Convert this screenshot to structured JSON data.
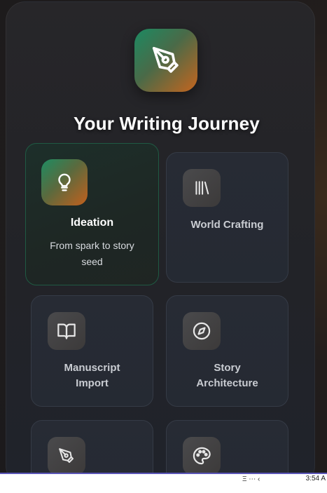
{
  "header": {
    "title": "Your Writing Journey",
    "icon": "pen-nib-icon"
  },
  "cards": [
    {
      "label": "Ideation",
      "description": "From spark to story seed",
      "icon": "lightbulb-icon",
      "active": true
    },
    {
      "label": "World Crafting",
      "icon": "library-icon",
      "active": false
    },
    {
      "label": "Manuscript Import",
      "icon": "open-book-icon",
      "active": false
    },
    {
      "label": "Story Architecture",
      "icon": "compass-icon",
      "active": false
    },
    {
      "label": "",
      "icon": "pen-nib-icon",
      "active": false
    },
    {
      "label": "",
      "icon": "palette-icon",
      "active": false
    }
  ],
  "taskbar": {
    "clock": "3:54 A",
    "tray_text": "Ξ ⋯ ‹"
  },
  "colors": {
    "accent_green": "#1c8a62",
    "accent_orange": "#c5651e",
    "panel_bg": "#24252a",
    "card_bg": "#272b34"
  }
}
